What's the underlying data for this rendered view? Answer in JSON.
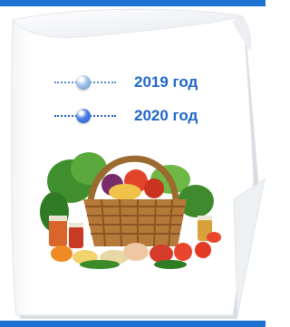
{
  "legend": {
    "items": [
      {
        "label": "2019 год",
        "color": "#5d8fca",
        "highlight": "#a9c7ea"
      },
      {
        "label": "2020 год",
        "color": "#1b56c9",
        "highlight": "#4f83e4"
      }
    ]
  },
  "illustration": {
    "subject": "vegetables-basket"
  },
  "colors": {
    "accent": "#1e73d2"
  }
}
